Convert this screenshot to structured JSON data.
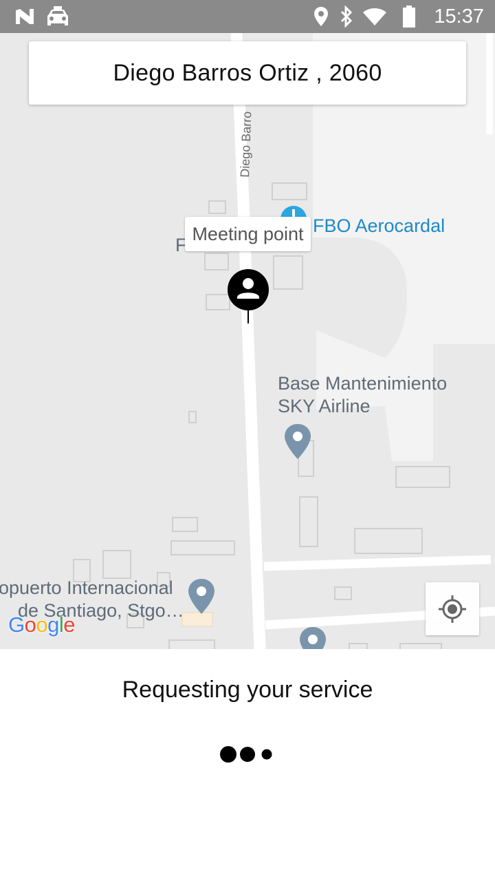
{
  "status_bar": {
    "time": "15:37",
    "icons": [
      "n-notification-icon",
      "taxi-icon",
      "location-icon",
      "bluetooth-icon",
      "wifi-icon",
      "battery-icon"
    ]
  },
  "map": {
    "address": "Diego Barros Ortiz , 2060",
    "street_label": "Diego Barro",
    "meeting_point_label": "Meeting point",
    "partial_label": "F",
    "pois": [
      {
        "name": "FBO Aerocardal"
      },
      {
        "name_line1": "Base Mantenimiento",
        "name_line2": "SKY Airline"
      },
      {
        "name_line1": "opuerto Internacional",
        "name_line2": "de Santiago, Stgo…"
      }
    ],
    "google_logo": "Google",
    "colors": {
      "poi_blue": "#1e88c9",
      "poi_gray": "#7a95ab",
      "map_bg": "#e9e9e9"
    }
  },
  "bottom": {
    "status_text": "Requesting your service"
  }
}
